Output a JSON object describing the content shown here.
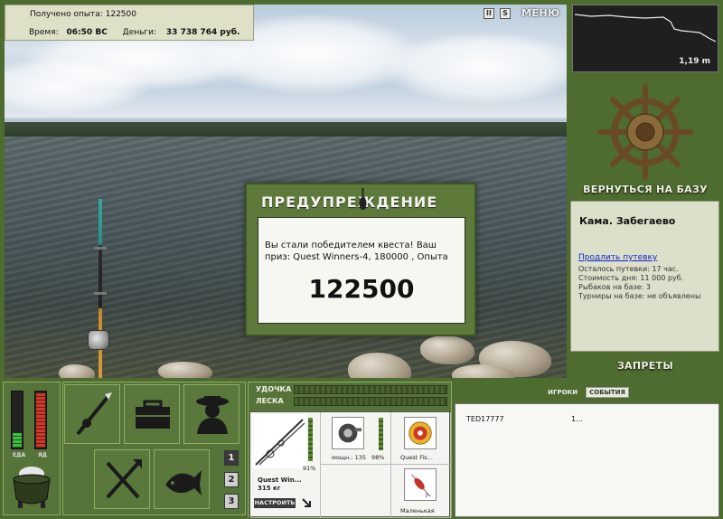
{
  "info": {
    "xp_label": "Получено опыта:",
    "xp_value": "122500",
    "time_label": "Время:",
    "time_value": "06:50 ВС",
    "money_label": "Деньги:",
    "money_value": "33 738 764 руб."
  },
  "top_controls": {
    "pause_label": "II",
    "sound_label": "S",
    "menu_label": "МЕНЮ"
  },
  "depth": {
    "value": "1,19 m"
  },
  "right_panel": {
    "return_label": "ВЕРНУТЬСЯ НА БАЗУ",
    "location": "Кама. Забегаево",
    "extend_link": "Продлить путевку",
    "lines": [
      "Осталось путевки: 17 час.",
      "Стоимость дня: 11 000 руб.",
      "Рыбаков на базе: 3",
      "Турниры на базе: не объявлены"
    ],
    "bans_label": "ЗАПРЕТЫ"
  },
  "modal": {
    "title": "ПРЕДУПРЕЖДЕНИЕ",
    "message": "Вы стали победителем квеста! Ваш приз: Quest Winners-4, 180000 , Опыта",
    "value": "122500"
  },
  "gauges": {
    "food_label": "ЕДА",
    "food_level": 0.25,
    "poison_label": "ЯД",
    "poison_level": 0.95,
    "food_color": "#3fbf3f",
    "poison_color": "#d03a2a"
  },
  "slots": [
    "1",
    "2",
    "3"
  ],
  "tackle": {
    "rod_label": "УДОЧКА",
    "line_label": "ЛЕСКА",
    "rod_name": "Quest Win...",
    "rod_weight": "315 кг",
    "rod_percent": "91%",
    "reel_name": "мощн.: 135",
    "reel_percent": "98%",
    "line_name": "Quest Fis...",
    "lure_name": "Маленькая",
    "setup_label": "НАСТРОИТЬ"
  },
  "chat": {
    "tab_players": "ИГРОКИ",
    "tab_events": "СОБЫТИЯ",
    "player": "TED17777",
    "message": "1..."
  },
  "colors": {
    "frame_green": "#4e6b30",
    "panel_beige": "#dcdfca",
    "link_blue": "#0a28c8"
  }
}
